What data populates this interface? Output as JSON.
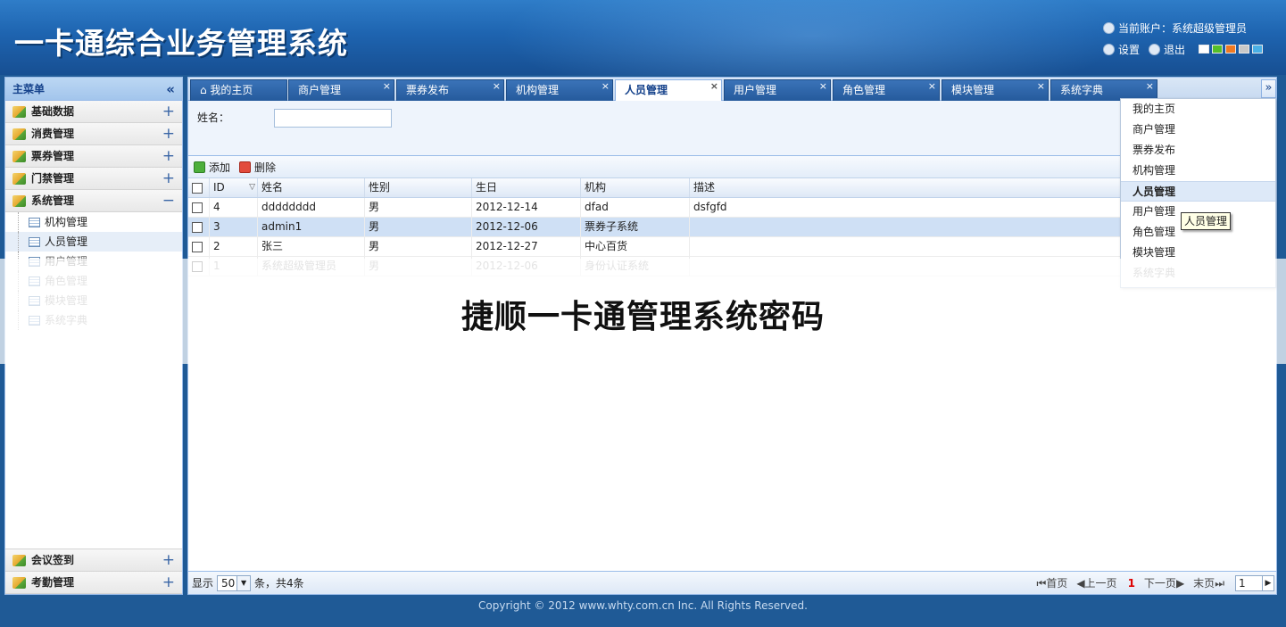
{
  "header": {
    "title": "一卡通综合业务管理系统",
    "account_label": "当前账户：系统超级管理员",
    "settings_label": "设置",
    "logout_label": "退出",
    "theme_colors": [
      "#ffffff",
      "#55c02a",
      "#f07a22",
      "#c8c8c8",
      "#4ab0e6"
    ]
  },
  "sidebar": {
    "title": "主菜单",
    "collapse_icon": "«",
    "groups_top": [
      {
        "label": "基础数据",
        "toggle": "+"
      },
      {
        "label": "消费管理",
        "toggle": "+"
      },
      {
        "label": "票券管理",
        "toggle": "+"
      },
      {
        "label": "门禁管理",
        "toggle": "+"
      },
      {
        "label": "系统管理",
        "toggle": "−"
      }
    ],
    "sub_items": [
      {
        "label": "机构管理"
      },
      {
        "label": "人员管理"
      },
      {
        "label": "用户管理"
      },
      {
        "label": "角色管理"
      },
      {
        "label": "模块管理"
      },
      {
        "label": "系统字典"
      }
    ],
    "groups_bottom": [
      {
        "label": "会议签到",
        "toggle": "+"
      },
      {
        "label": "考勤管理",
        "toggle": "+"
      }
    ]
  },
  "tabs": [
    {
      "label": "我的主页",
      "close": ""
    },
    {
      "label": "商户管理",
      "close": "×"
    },
    {
      "label": "票券发布",
      "close": "×"
    },
    {
      "label": "机构管理",
      "close": "×"
    },
    {
      "label": "人员管理",
      "close": "×"
    },
    {
      "label": "用户管理",
      "close": "×"
    },
    {
      "label": "角色管理",
      "close": "×"
    },
    {
      "label": "模块管理",
      "close": "×"
    },
    {
      "label": "系统字典",
      "close": "×"
    }
  ],
  "tab_scroll_icon": "»",
  "search": {
    "name_label": "姓名："
  },
  "toolbar": {
    "add_label": "添加",
    "delete_label": "删除"
  },
  "grid": {
    "columns": [
      "ID",
      "姓名",
      "性别",
      "生日",
      "机构",
      "描述"
    ],
    "rows": [
      {
        "id": "4",
        "name": "dddddddd",
        "gender": "男",
        "birthday": "2012-12-14",
        "org": "dfad",
        "desc": "dsfgfd"
      },
      {
        "id": "3",
        "name": "admin1",
        "gender": "男",
        "birthday": "2012-12-06",
        "org": "票券子系统",
        "desc": ""
      },
      {
        "id": "2",
        "name": "张三",
        "gender": "男",
        "birthday": "2012-12-27",
        "org": "中心百货",
        "desc": ""
      },
      {
        "id": "1",
        "name": "系统超级管理员",
        "gender": "男",
        "birthday": "2012-12-06",
        "org": "身份认证系统",
        "desc": ""
      }
    ]
  },
  "dropdown_items": [
    "我的主页",
    "商户管理",
    "票券发布",
    "机构管理",
    "人员管理",
    "用户管理",
    "角色管理",
    "模块管理",
    "系统字典"
  ],
  "tooltip": "人员管理",
  "overlay_text": "捷顺一卡通管理系统密码",
  "pager": {
    "show_label": "显示",
    "page_size": "50",
    "summary": "条，共4条",
    "first": "首页",
    "prev": "上一页",
    "current": "1",
    "next": "下一页",
    "last": "末页",
    "page_input": "1"
  },
  "footer": "Copyright © 2012 www.whty.com.cn Inc. All Rights Reserved."
}
